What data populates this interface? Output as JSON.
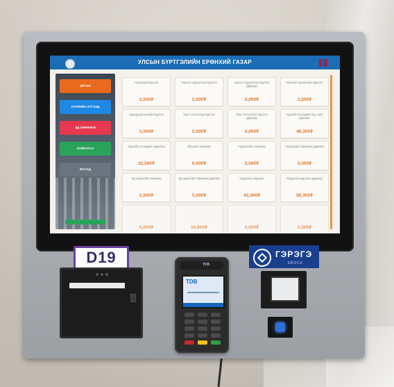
{
  "screen": {
    "title": "УЛСЫН БҮРТГЭЛИЙН ЕРӨНХИЙ ГАЗАР",
    "sidebar": {
      "items": [
        {
          "label": "ИРГЭН",
          "color": "#e96a1e"
        },
        {
          "label": "ХУУЛИЙН ЭТГЭЭД",
          "color": "#1e88e5"
        },
        {
          "label": "ЭД ХӨРӨНГӨ",
          "color": "#e53950"
        },
        {
          "label": "ЛАВЛАГАА",
          "color": "#2aa35a"
        },
        {
          "label": "БУСАД",
          "color": "#6b7580"
        }
      ]
    },
    "tiles": [
      {
        "label": "Гэрлэсний бүртгэл",
        "price": "2,500₮"
      },
      {
        "label": "Гэрлэлт цуцлалтын бүртгэл",
        "price": "2,500₮"
      },
      {
        "label": "Гэрлэлт цуцлалтын бүртгэл (давхар)",
        "price": "5,000₮"
      },
      {
        "label": "Иргэний гэрлэлтийн бүртгэл",
        "price": "2,500₮"
      },
      {
        "label": "Хүүхэд үрчлэлтийн бүртгэл",
        "price": "5,000₮"
      },
      {
        "label": "Эцэг тогтоолтын бүртгэл",
        "price": "2,500₮"
      },
      {
        "label": "Эцэг тогтоолтын бүртгэл (давхар)",
        "price": "5,000₮"
      },
      {
        "label": "Хуулийн этгээдийн нэр, хаяг өөрчлөх",
        "price": "48,300₮"
      },
      {
        "label": "Хуулийн этгээдийн лавлагаа",
        "price": "32,500₮"
      },
      {
        "label": "Иргэний лавлагаа",
        "price": "6,000₮"
      },
      {
        "label": "Гэрлэлтийн лавлагаа",
        "price": "2,500₮"
      },
      {
        "label": "Гэрлэлтийн лавлагаа (давхар)",
        "price": "5,000₮"
      },
      {
        "label": "Эд хөрөнгийн лавлагаа",
        "price": "2,500₮"
      },
      {
        "label": "Эд хөрөнгийн лавлагаа (давхар)",
        "price": "5,000₮"
      },
      {
        "label": "Мэдээлэл өөрчлөх",
        "price": "43,300₮"
      },
      {
        "label": "Мэдээлэл өөрчлөх (давхар)",
        "price": "58,300₮"
      },
      {
        "label": "",
        "price": "5,000₮"
      },
      {
        "label": "",
        "price": "10,000₮"
      },
      {
        "label": "",
        "price": "2,500₮"
      },
      {
        "label": "",
        "price": "5,500₮"
      }
    ]
  },
  "labels": {
    "d19": "D19",
    "gerege_name": "ГЭРЭГЭ",
    "gerege_sub": "КИОСК",
    "terminal_top": "TDB",
    "bank": "TDB"
  },
  "colors": {
    "screen_topbar": "#1c6db5",
    "price_accent": "#e0782a",
    "gerege_blue": "#1a3f8f",
    "d19_border": "#6b3fa3"
  }
}
